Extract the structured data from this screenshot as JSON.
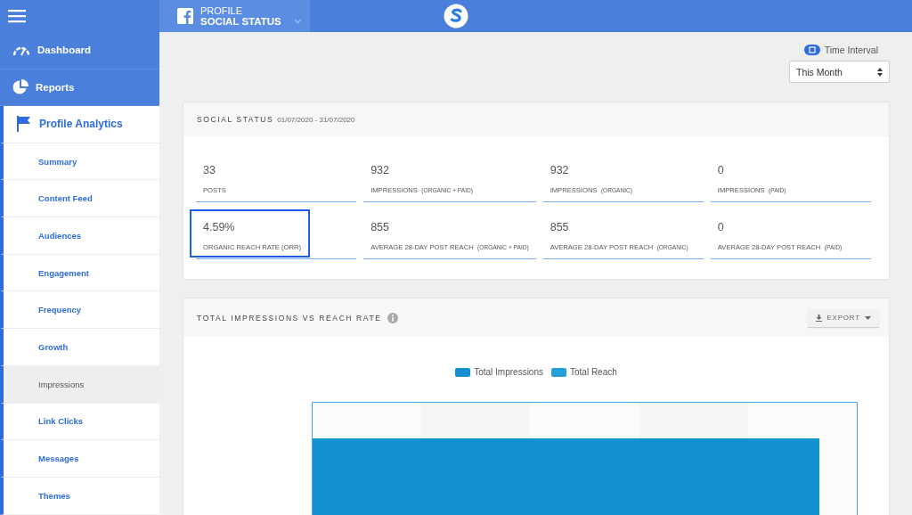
{
  "header": {
    "profile_label": "PROFILE",
    "profile_name": "SOCIAL STATUS"
  },
  "sidebar": {
    "items": [
      {
        "kind": "main",
        "label": "Dashboard",
        "selected": false
      },
      {
        "kind": "main",
        "label": "Reports",
        "selected": false
      },
      {
        "kind": "group",
        "label": "Profile Analytics",
        "selected": false
      },
      {
        "kind": "sub",
        "label": "Summary",
        "selected": false
      },
      {
        "kind": "sub",
        "label": "Content Feed",
        "selected": false
      },
      {
        "kind": "sub",
        "label": "Audiences",
        "selected": false
      },
      {
        "kind": "sub",
        "label": "Engagement",
        "selected": false
      },
      {
        "kind": "sub",
        "label": "Frequency",
        "selected": false
      },
      {
        "kind": "sub",
        "label": "Growth",
        "selected": false
      },
      {
        "kind": "sub",
        "label": "Impressions",
        "selected": true
      },
      {
        "kind": "sub",
        "label": "Link Clicks",
        "selected": false
      },
      {
        "kind": "sub",
        "label": "Messages",
        "selected": false
      },
      {
        "kind": "sub",
        "label": "Themes",
        "selected": false
      }
    ]
  },
  "time_interval": {
    "label": "Time Interval",
    "value": "This Month"
  },
  "social_status": {
    "title": "SOCIAL STATUS",
    "date_range": "01/07/2020 - 31/07/2020",
    "stats": [
      {
        "value": "33",
        "label": "POSTS",
        "highlighted": false
      },
      {
        "value": "932",
        "label": "IMPRESSIONS",
        "qualifier": "(ORGANIC + PAID)",
        "highlighted": false
      },
      {
        "value": "932",
        "label": "IMPRESSIONS",
        "qualifier": "(ORGANIC)",
        "highlighted": false
      },
      {
        "value": "0",
        "label": "IMPRESSIONS",
        "qualifier": "(PAID)",
        "highlighted": false
      },
      {
        "value": "4.59%",
        "label": "ORGANIC REACH RATE (ORR)",
        "highlighted": true
      },
      {
        "value": "855",
        "label": "AVERAGE 28-DAY POST REACH",
        "qualifier": "(ORGANIC + PAID)",
        "highlighted": false
      },
      {
        "value": "855",
        "label": "AVERAGE 28-DAY POST REACH",
        "qualifier": "(ORGANIC)",
        "highlighted": false
      },
      {
        "value": "0",
        "label": "AVERAGE 28-DAY POST REACH",
        "qualifier": "(PAID)",
        "highlighted": false
      }
    ]
  },
  "impressions_card": {
    "title": "TOTAL IMPRESSIONS VS REACH RATE",
    "export": "EXPORT",
    "legend": [
      {
        "label": "Total Impressions",
        "color": "#1590d0"
      },
      {
        "label": "Total Reach",
        "color": "#25a0da"
      }
    ]
  }
}
